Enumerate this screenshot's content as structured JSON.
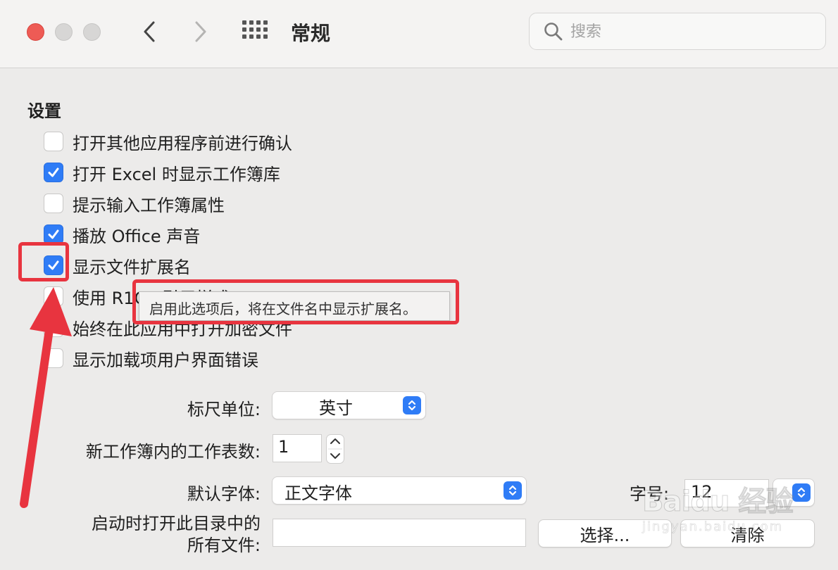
{
  "window": {
    "title": "常规",
    "search_placeholder": "搜索"
  },
  "settings": {
    "heading": "设置",
    "options": [
      {
        "label": "打开其他应用程序前进行确认",
        "checked": false
      },
      {
        "label": "打开 Excel 时显示工作簿库",
        "checked": true
      },
      {
        "label": "提示输入工作簿属性",
        "checked": false
      },
      {
        "label": "播放 Office 声音",
        "checked": true
      },
      {
        "label": "显示文件扩展名",
        "checked": true
      },
      {
        "label": "使用 R1C1 引用样式",
        "checked": false
      },
      {
        "label": "始终在此应用中打开加密文件",
        "checked": false
      },
      {
        "label": "显示加载项用户界面错误",
        "checked": false
      }
    ],
    "tooltip": "启用此选项后，将在文件名中显示扩展名。"
  },
  "fields": {
    "ruler_label": "标尺单位:",
    "ruler_value": "英寸",
    "sheets_label": "新工作簿内的工作表数:",
    "sheets_value": "1",
    "font_label": "默认字体:",
    "font_value": "正文字体",
    "size_label": "字号:",
    "size_value": "12",
    "startup_label_line1": "启动时打开此目录中的",
    "startup_label_line2": "所有文件:",
    "startup_value": "",
    "choose_button": "选择...",
    "clear_button": "清除"
  },
  "watermark": {
    "main": "Baidu 经验",
    "sub": "jingyan.baidu.com"
  },
  "colors": {
    "accent": "#2f7cf6",
    "annotation": "#e8343f",
    "close": "#ee5b55"
  }
}
